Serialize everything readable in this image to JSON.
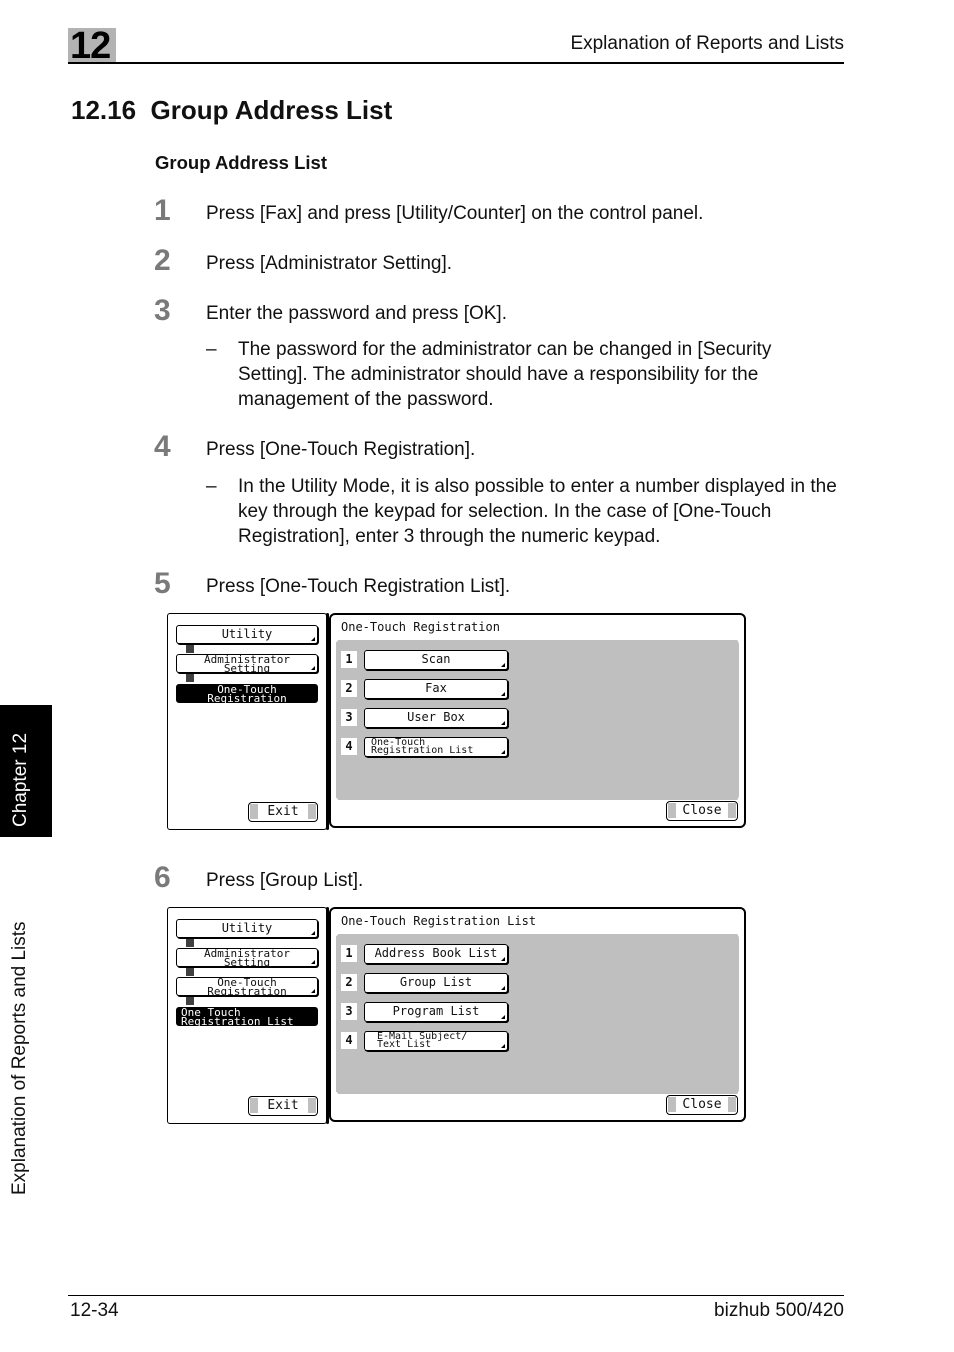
{
  "header": {
    "chapter_number": "12",
    "running_title": "Explanation of Reports and Lists"
  },
  "section": {
    "title": "12.16  Group Address List",
    "subtitle": "Group Address List"
  },
  "steps": [
    {
      "num": "1",
      "text": "Press [Fax] and press [Utility/Counter] on the control panel."
    },
    {
      "num": "2",
      "text": "Press [Administrator Setting]."
    },
    {
      "num": "3",
      "text": "Enter the password and press [OK].",
      "note": "The password for the administrator can be changed in [Security Setting]. The administrator should have a responsibility for the management of the password."
    },
    {
      "num": "4",
      "text": "Press [One-Touch Registration].",
      "note": "In the Utility Mode, it is also possible to enter a number displayed in the key through the keypad for selection. In the case of [One-Touch Registration], enter 3 through the numeric keypad."
    },
    {
      "num": "5",
      "text": "Press [One-Touch Registration List]."
    },
    {
      "num": "6",
      "text": "Press [Group List]."
    }
  ],
  "note_dash": "–",
  "screen1": {
    "left_buttons": [
      "Utility",
      "Administrator\nSetting"
    ],
    "selected": "One-Touch\nRegistration",
    "exit_label": "Exit",
    "title": "One-Touch Registration",
    "items": [
      {
        "num": "1",
        "label": "Scan"
      },
      {
        "num": "2",
        "label": "Fax"
      },
      {
        "num": "3",
        "label": "User Box"
      },
      {
        "num": "4",
        "label": "One-Touch\nRegistration List"
      }
    ],
    "close_label": "Close"
  },
  "screen2": {
    "left_buttons": [
      "Utility",
      "Administrator\nSetting",
      "One-Touch\nRegistration"
    ],
    "selected": "One Touch\nRegistration List",
    "exit_label": "Exit",
    "title": "One-Touch Registration List",
    "items": [
      {
        "num": "1",
        "label": "Address Book List"
      },
      {
        "num": "2",
        "label": "Group List"
      },
      {
        "num": "3",
        "label": "Program List"
      },
      {
        "num": "4",
        "label": "E-Mail Subject/\nText List"
      }
    ],
    "close_label": "Close"
  },
  "side_tab": {
    "chapter": "Chapter 12",
    "section": "Explanation of Reports and Lists"
  },
  "footer": {
    "page": "12-34",
    "product": "bizhub 500/420"
  }
}
